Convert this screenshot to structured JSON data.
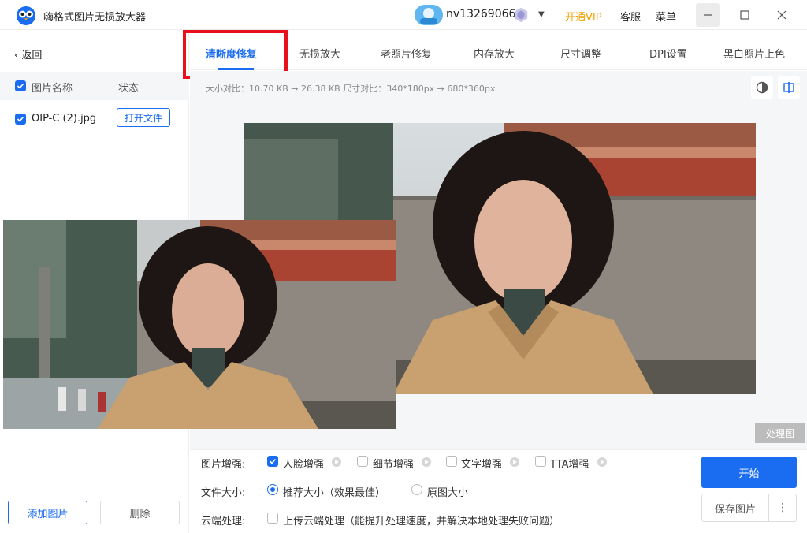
{
  "app": {
    "title": "嗨格式图片无损放大器",
    "logo_icon": "owl-logo-icon"
  },
  "header": {
    "username": "nv13269066",
    "vip_link": "开通VIP",
    "service": "客服",
    "menu": "菜单",
    "vip_color": "#f5a000"
  },
  "sidebar": {
    "back": "返回",
    "col_name": "图片名称",
    "col_status": "状态",
    "files": [
      {
        "name": "OIP-C (2).jpg",
        "action": "打开文件",
        "checked": true
      }
    ],
    "add_button": "添加图片",
    "delete_button": "删除"
  },
  "tabs": [
    {
      "label": "清晰度修复",
      "active": true
    },
    {
      "label": "无损放大",
      "active": false
    },
    {
      "label": "老照片修复",
      "active": false
    },
    {
      "label": "内存放大",
      "active": false
    },
    {
      "label": "尺寸调整",
      "active": false
    },
    {
      "label": "DPI设置",
      "active": false
    },
    {
      "label": "黑白照片上色",
      "active": false
    }
  ],
  "preview": {
    "size_info": "大小对比：10.70 KB → 26.38 KB   尺寸对比：340*180px → 680*360px",
    "process_badge": "处理图"
  },
  "settings": {
    "enhance_label": "图片增强:",
    "enhance_options": [
      {
        "label": "人脸增强",
        "checked": true
      },
      {
        "label": "细节增强",
        "checked": false
      },
      {
        "label": "文字增强",
        "checked": false
      },
      {
        "label": "TTA增强",
        "checked": false
      }
    ],
    "filesize_label": "文件大小:",
    "filesize_options": [
      {
        "label": "推荐大小（效果最佳）",
        "selected": true
      },
      {
        "label": "原图大小",
        "selected": false
      }
    ],
    "cloud_label": "云端处理:",
    "cloud_option": "上传云端处理（能提升处理速度，并解决本地处理失败问题）",
    "start_button": "开始",
    "save_button": "保存图片",
    "more_button": "⋮"
  },
  "accent_color": "#1a6cf0",
  "highlight_color": "#e8101a"
}
